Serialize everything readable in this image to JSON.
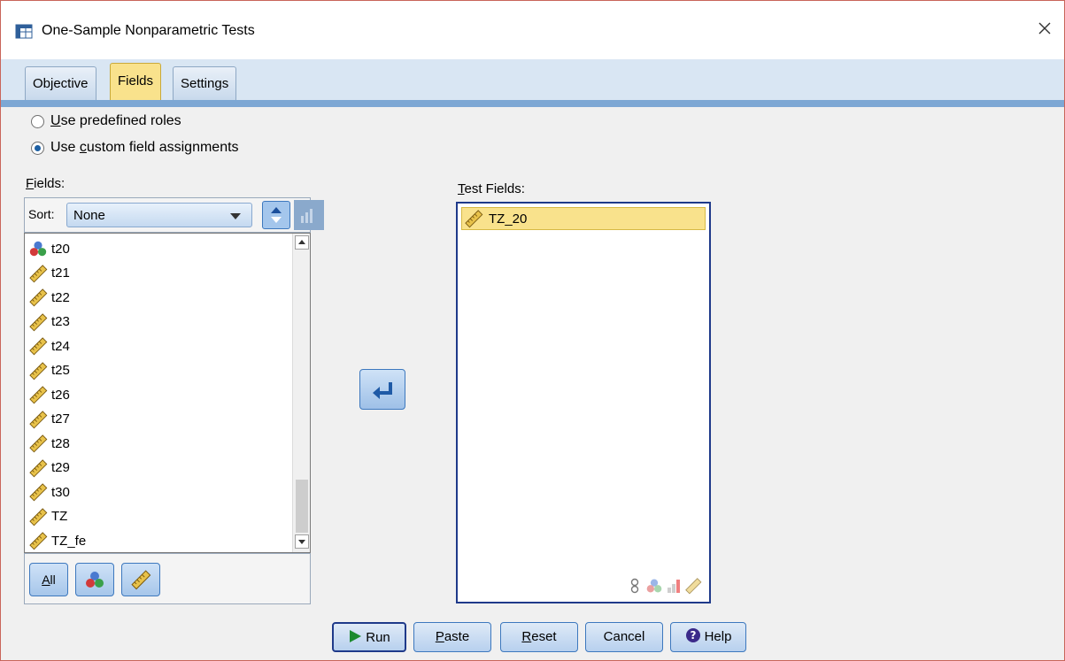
{
  "window": {
    "title": "One-Sample Nonparametric Tests"
  },
  "tabs": [
    {
      "label": "Objective",
      "active": false
    },
    {
      "label": "Fields",
      "active": true
    },
    {
      "label": "Settings",
      "active": false
    }
  ],
  "roles": {
    "predefined_pre": "",
    "predefined_key": "U",
    "predefined_post": "se predefined roles",
    "custom_pre": "Use ",
    "custom_key": "c",
    "custom_post": "ustom field assignments",
    "selected": "custom"
  },
  "fields_label": {
    "key": "F",
    "rest": "ields:"
  },
  "sort": {
    "label": "Sort:",
    "value": "None"
  },
  "fields": [
    {
      "name": "t20",
      "icon": "nominal-icon"
    },
    {
      "name": "t21",
      "icon": "scale-icon"
    },
    {
      "name": "t22",
      "icon": "scale-icon"
    },
    {
      "name": "t23",
      "icon": "scale-icon"
    },
    {
      "name": "t24",
      "icon": "scale-icon"
    },
    {
      "name": "t25",
      "icon": "scale-icon"
    },
    {
      "name": "t26",
      "icon": "scale-icon"
    },
    {
      "name": "t27",
      "icon": "scale-icon"
    },
    {
      "name": "t28",
      "icon": "scale-icon"
    },
    {
      "name": "t29",
      "icon": "scale-icon"
    },
    {
      "name": "t30",
      "icon": "scale-icon"
    },
    {
      "name": "TZ",
      "icon": "scale-icon"
    },
    {
      "name": "TZ_fe",
      "icon": "scale-icon"
    }
  ],
  "filter_buttons": {
    "all_key": "A",
    "all_rest": "ll"
  },
  "test_fields_label": {
    "key": "T",
    "rest": "est Fields:"
  },
  "test_fields": [
    {
      "name": "TZ_20",
      "icon": "scale-icon"
    }
  ],
  "buttons": {
    "run": "Run",
    "paste_key": "P",
    "paste_rest": "aste",
    "reset_key": "R",
    "reset_rest": "eset",
    "cancel": "Cancel",
    "help": "Help"
  }
}
